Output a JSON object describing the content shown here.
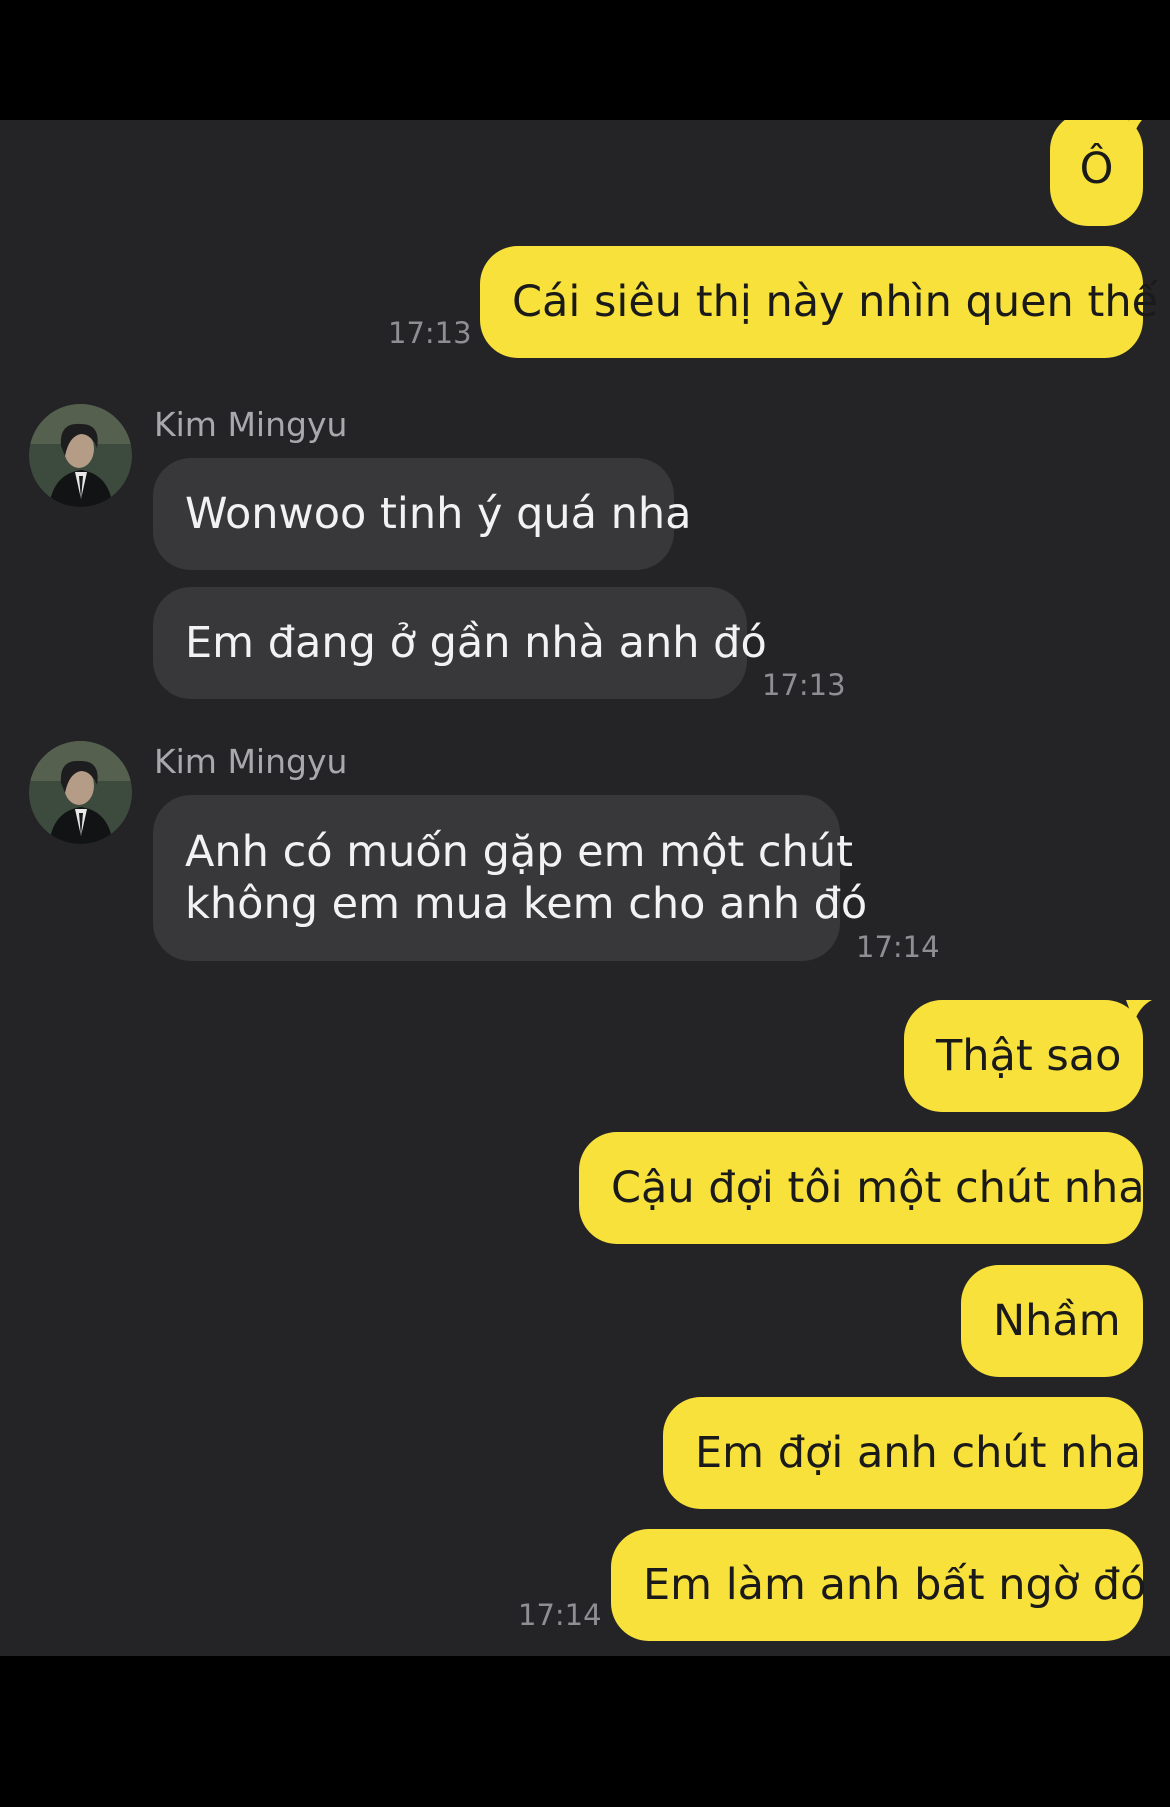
{
  "colors": {
    "background": "#242426",
    "outgoing_bubble": "#f7e13a",
    "incoming_bubble": "#38383b",
    "timestamp": "#8e8e93"
  },
  "messages": {
    "m1": {
      "text": "Ô"
    },
    "m2": {
      "text": "Cái siêu thị này nhìn quen thế",
      "time": "17:13"
    },
    "g1": {
      "sender": "Kim Mingyu",
      "avatar_icon": "profile-photo-man-in-suit",
      "m3": {
        "text": "Wonwoo tinh ý quá nha"
      },
      "m4": {
        "text": "Em đang ở gần nhà anh đó",
        "time": "17:13"
      }
    },
    "g2": {
      "sender": "Kim Mingyu",
      "avatar_icon": "profile-photo-man-in-suit",
      "m5": {
        "line1": "Anh có muốn gặp em một chút",
        "line2": "không em mua kem cho anh đó",
        "time": "17:14"
      }
    },
    "m6": {
      "text": "Thật sao"
    },
    "m7": {
      "text": "Cậu đợi tôi một chút nha"
    },
    "m8": {
      "text": "Nhầm"
    },
    "m9": {
      "text": "Em đợi anh chút nha"
    },
    "m10": {
      "text": "Em làm anh bất ngờ đó",
      "time": "17:14"
    }
  }
}
